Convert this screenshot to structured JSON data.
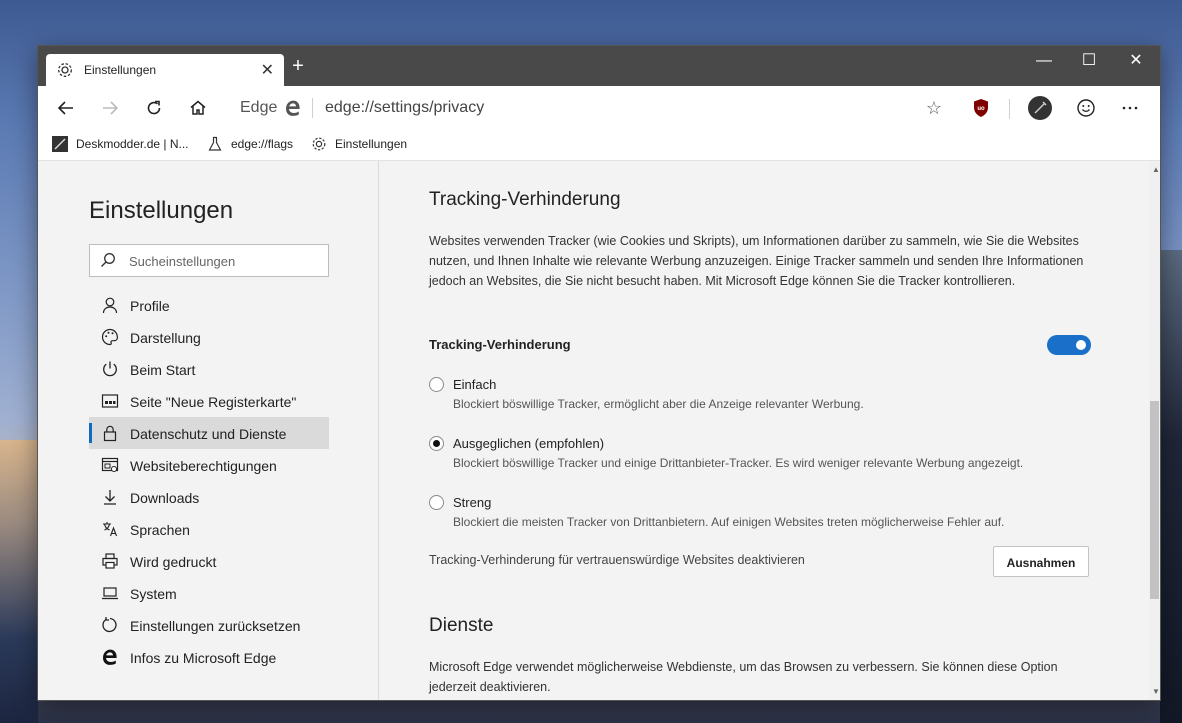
{
  "tab": {
    "title": "Einstellungen",
    "close": "✕",
    "new_tab": "+"
  },
  "window_controls": {
    "minimize": "—",
    "maximize": "☐",
    "close": "✕"
  },
  "address": {
    "brand": "Edge",
    "url": "edge://settings/privacy"
  },
  "favorites": [
    {
      "label": "Deskmodder.de | N...",
      "icon": "deskmodder-icon"
    },
    {
      "label": "edge://flags",
      "icon": "flask-icon"
    },
    {
      "label": "Einstellungen",
      "icon": "gear-icon"
    }
  ],
  "sidebar": {
    "title": "Einstellungen",
    "search_placeholder": "Sucheinstellungen",
    "items": [
      {
        "label": "Profile",
        "icon": "person-icon"
      },
      {
        "label": "Darstellung",
        "icon": "palette-icon"
      },
      {
        "label": "Beim Start",
        "icon": "power-icon"
      },
      {
        "label": "Seite \"Neue Registerkarte\"",
        "icon": "newtab-page-icon"
      },
      {
        "label": "Datenschutz und Dienste",
        "icon": "lock-icon",
        "active": true
      },
      {
        "label": "Websiteberechtigungen",
        "icon": "site-permissions-icon"
      },
      {
        "label": "Downloads",
        "icon": "download-icon"
      },
      {
        "label": "Sprachen",
        "icon": "language-icon"
      },
      {
        "label": "Wird gedruckt",
        "icon": "printer-icon"
      },
      {
        "label": "System",
        "icon": "laptop-icon"
      },
      {
        "label": "Einstellungen zurücksetzen",
        "icon": "reset-icon"
      },
      {
        "label": "Infos zu Microsoft Edge",
        "icon": "edge-logo-icon"
      }
    ]
  },
  "main": {
    "tracking": {
      "heading": "Tracking-Verhinderung",
      "description": "Websites verwenden Tracker (wie Cookies und Skripts), um Informationen darüber zu sammeln, wie Sie die Websites nutzen, und Ihnen Inhalte wie relevante Werbung anzuzeigen. Einige Tracker sammeln und senden Ihre Informationen jedoch an Websites, die Sie nicht besucht haben. Mit Microsoft Edge können Sie die Tracker kontrollieren.",
      "toggle_label": "Tracking-Verhinderung",
      "toggle_on": true,
      "options": [
        {
          "label": "Einfach",
          "desc": "Blockiert böswillige Tracker, ermöglicht aber die Anzeige relevanter Werbung.",
          "checked": false
        },
        {
          "label": "Ausgeglichen (empfohlen)",
          "desc": "Blockiert böswillige Tracker und einige Drittanbieter-Tracker. Es wird weniger relevante Werbung angezeigt.",
          "checked": true
        },
        {
          "label": "Streng",
          "desc": "Blockiert die meisten Tracker von Drittanbietern. Auf einigen Websites treten möglicherweise Fehler auf.",
          "checked": false
        }
      ],
      "exceptions_text": "Tracking-Verhinderung für vertrauenswürdige Websites deaktivieren",
      "exceptions_button": "Ausnahmen"
    },
    "services": {
      "heading": "Dienste",
      "description": "Microsoft Edge verwendet möglicherweise Webdienste, um das Browsen zu verbessern. Sie können diese Option jederzeit deaktivieren."
    }
  },
  "colors": {
    "accent": "#1a6fc9",
    "titlebar": "#494949",
    "content_bg": "#f3f3f3"
  }
}
